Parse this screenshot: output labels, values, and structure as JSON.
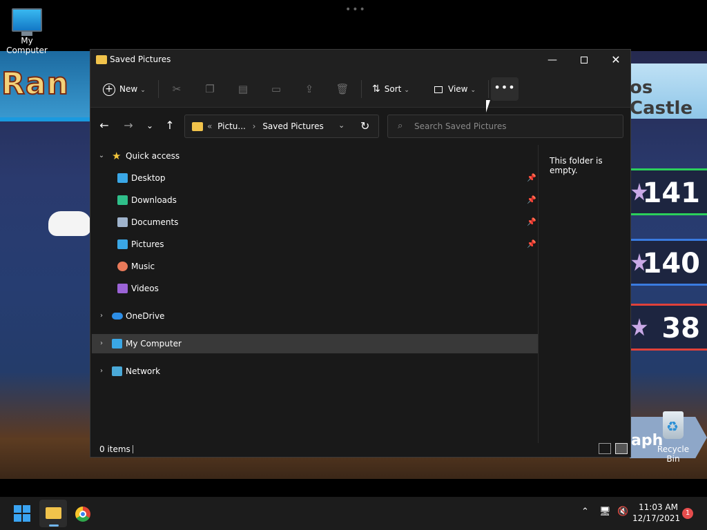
{
  "desktop": {
    "icons": {
      "my_computer": "My Computer",
      "recycle_bin": "Recycle Bin"
    },
    "wallpaper": {
      "left_banner": "Ran",
      "right_banner": "os Castle",
      "scores": [
        "141",
        "140",
        "38"
      ],
      "graph_label": "aph"
    }
  },
  "window": {
    "title": "Saved Pictures",
    "controls": {
      "minimize": "—",
      "close": "✕"
    },
    "toolbar": {
      "new_label": "New",
      "sort_label": "Sort",
      "view_label": "View",
      "more_label": "•••"
    },
    "address": {
      "prefix": "«",
      "crumbs": [
        "Pictu...",
        "Saved Pictures"
      ]
    },
    "search": {
      "placeholder": "Search Saved Pictures"
    },
    "nav": {
      "quick_access": "Quick access",
      "items": [
        {
          "label": "Desktop",
          "icon": "desktop-icon",
          "color": "#3aa7e6"
        },
        {
          "label": "Downloads",
          "icon": "download-icon",
          "color": "#2fbf8a"
        },
        {
          "label": "Documents",
          "icon": "document-icon",
          "color": "#9fb3cc"
        },
        {
          "label": "Pictures",
          "icon": "picture-icon",
          "color": "#3aa7e6"
        },
        {
          "label": "Music",
          "icon": "music-icon",
          "color": "#e87a5a"
        },
        {
          "label": "Videos",
          "icon": "video-icon",
          "color": "#9b63d6"
        }
      ],
      "onedrive": "OneDrive",
      "my_computer": "My Computer",
      "network": "Network"
    },
    "detail": {
      "empty_message": "This folder is empty."
    },
    "status": {
      "count": "0 items"
    }
  },
  "taskbar": {
    "time": "11:03 AM",
    "date": "12/17/2021",
    "notification_count": "1"
  },
  "colors": {
    "accent": "#3aa4f2",
    "folder": "#f1c34b",
    "window_bg": "#191919",
    "selection": "#393939"
  }
}
